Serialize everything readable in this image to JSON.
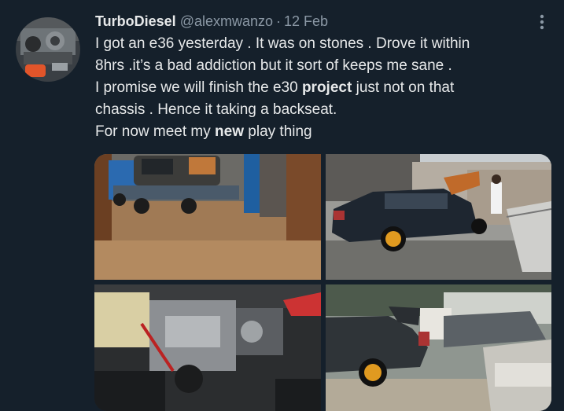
{
  "tweet": {
    "author": {
      "display_name": "TurboDiesel",
      "handle": "@alexmwanzo"
    },
    "separator": "·",
    "date": "12 Feb",
    "more_icon": "more-vertical-icon",
    "text_lines": [
      {
        "parts": [
          {
            "text": "I got an e36 yesterday . It was on stones . Drove it within",
            "bold": false
          }
        ]
      },
      {
        "parts": [
          {
            "text": "8hrs .it’s a bad addiction but it sort of keeps me sane .",
            "bold": false
          }
        ]
      },
      {
        "parts": [
          {
            "text": "I promise we will finish the e30 ",
            "bold": false
          },
          {
            "text": "project",
            "bold": true
          },
          {
            "text": " just not on that",
            "bold": false
          }
        ]
      },
      {
        "parts": [
          {
            "text": "chassis . Hence it taking a backseat.",
            "bold": false
          }
        ]
      },
      {
        "parts": [
          {
            "text": "For now meet my ",
            "bold": false
          },
          {
            "text": "new",
            "bold": true
          },
          {
            "text": " play thing",
            "bold": false
          }
        ]
      }
    ],
    "media": {
      "photos": [
        {
          "subject": "flatbed-tow-truck-carrying-car"
        },
        {
          "subject": "dark-blue-bmw-e36-in-yard"
        },
        {
          "subject": "engine-bay"
        },
        {
          "subject": "bmw-e36-with-open-trunk"
        }
      ]
    }
  },
  "colors": {
    "background": "#15202b",
    "primary_text": "#e7e9ea",
    "secondary_text": "#8b98a5"
  }
}
